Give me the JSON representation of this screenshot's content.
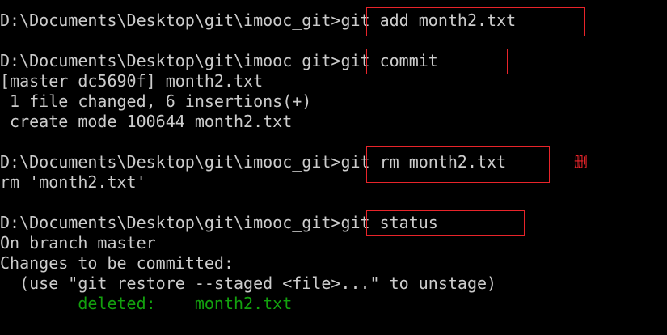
{
  "terminal": {
    "prompt": "D:\\Documents\\Desktop\\git\\imooc_git>",
    "cmd_add": "git add month2.txt",
    "cmd_commit": "git commit",
    "commit_output": [
      "[master dc5690f] month2.txt",
      " 1 file changed, 6 insertions(+)",
      " create mode 100644 month2.txt"
    ],
    "cmd_rm": "git rm month2.txt",
    "rm_output": "rm 'month2.txt'",
    "cmd_status": "git status",
    "status_output": [
      "On branch master",
      "Changes to be committed:",
      "  (use \"git restore --staged <file>...\" to unstage)"
    ],
    "deleted_indent": "        ",
    "deleted_label": "deleted:    month2.txt"
  },
  "annotation": {
    "note": "删",
    "color": "#e8242a"
  },
  "colors": {
    "background": "#000000",
    "text": "#cccccc",
    "deleted": "#13a10e"
  }
}
